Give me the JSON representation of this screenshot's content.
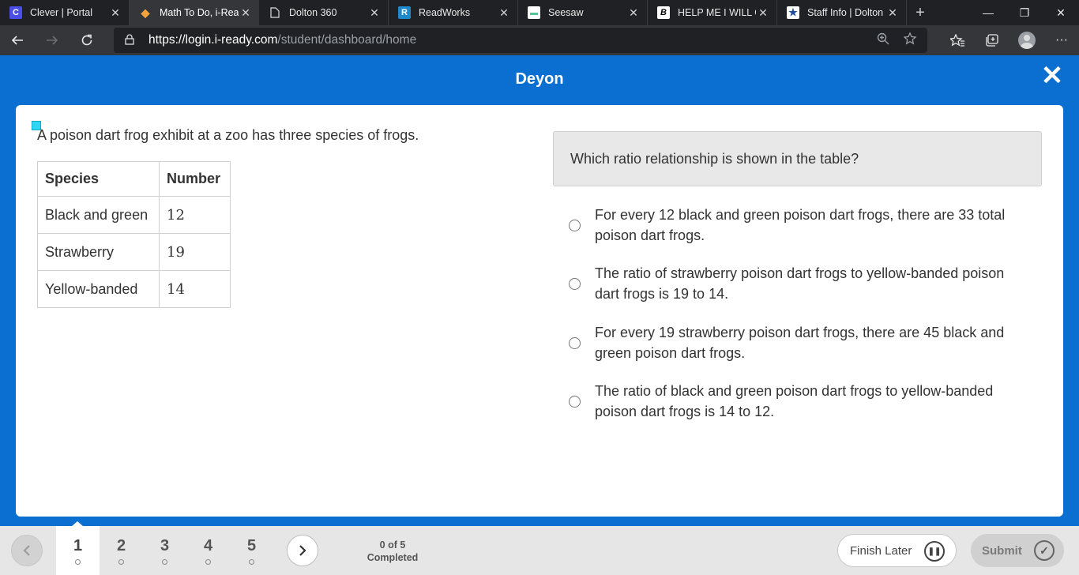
{
  "browser": {
    "tabs": [
      {
        "title": "Clever | Portal",
        "favicon": "C",
        "favicon_color": "#4a4de6"
      },
      {
        "title": "Math To Do, i-Rea",
        "favicon": "◆",
        "favicon_color": "#f2a33a"
      },
      {
        "title": "Dolton 360",
        "favicon": "📄",
        "favicon_color": "#202124"
      },
      {
        "title": "ReadWorks",
        "favicon": "R",
        "favicon_color": "#1e88c8"
      },
      {
        "title": "Seesaw",
        "favicon": "▬",
        "favicon_color": "#56c595"
      },
      {
        "title": "HELP ME I WILL GI",
        "favicon": "B",
        "favicon_color": "#202124"
      },
      {
        "title": "Staff Info | Dolton",
        "favicon": "★",
        "favicon_color": "#1f4f9e"
      }
    ],
    "new_tab": "+",
    "url_host": "https://login.i-ready.com",
    "url_path": "/student/dashboard/home"
  },
  "app": {
    "student_name": "Deyon",
    "close": "✕"
  },
  "question": {
    "stem": "A poison dart frog exhibit at a zoo has three species of frogs.",
    "table": {
      "headers": [
        "Species",
        "Number"
      ],
      "rows": [
        [
          "Black and green",
          "12"
        ],
        [
          "Strawberry",
          "19"
        ],
        [
          "Yellow-banded",
          "14"
        ]
      ]
    },
    "prompt": "Which ratio relationship is shown in the table?",
    "choices": [
      "For every 12 black and green poison dart frogs, there are 33 total poison dart frogs.",
      "The ratio of strawberry poison dart frogs to yellow-banded poison dart frogs is 19 to 14.",
      "For every 19 strawberry poison dart frogs, there are 45 black and green poison dart frogs.",
      "The ratio of black and green poison dart frogs to yellow-banded poison dart frogs is 14 to 12."
    ]
  },
  "footer": {
    "questions": [
      "1",
      "2",
      "3",
      "4",
      "5"
    ],
    "current": "1",
    "progress_count": "0 of 5",
    "progress_label": "Completed",
    "finish_later": "Finish Later",
    "submit": "Submit"
  },
  "colors": {
    "brand_blue": "#0b6fd1",
    "marker": "#2fd6f5"
  }
}
